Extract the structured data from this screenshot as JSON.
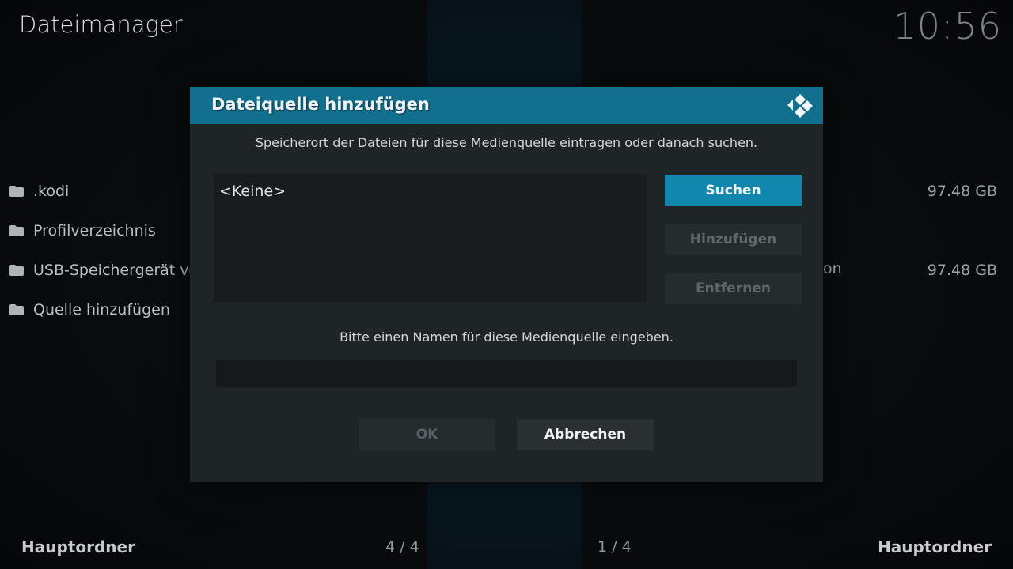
{
  "app": {
    "title": "Dateimanager",
    "clock": "10:56"
  },
  "left_pane": {
    "items": [
      {
        "label": ".kodi"
      },
      {
        "label": "Profilverzeichnis"
      },
      {
        "label": "USB-Speichergerät vo"
      },
      {
        "label": "Quelle hinzufügen"
      }
    ],
    "footer_title": "Hauptordner",
    "footer_count": "4 / 4"
  },
  "right_pane": {
    "sizes": [
      "97.48 GB",
      "97.48 GB"
    ],
    "partial_label": "on",
    "footer_title": "Hauptordner",
    "footer_count": "1 / 4"
  },
  "dialog": {
    "title": "Dateiquelle hinzufügen",
    "location_hint": "Speicherort der Dateien für diese Medienquelle eintragen oder danach suchen.",
    "path_items": [
      "<Keine>"
    ],
    "buttons": {
      "browse": "Suchen",
      "add": "Hinzufügen",
      "remove": "Entfernen"
    },
    "name_hint": "Bitte einen Namen für diese Medienquelle eingeben.",
    "name_value": "",
    "ok": "OK",
    "cancel": "Abbrechen",
    "logo_icon": "kodi-logo-icon"
  },
  "colors": {
    "accent": "#12708f",
    "focus": "#1287ad",
    "dialog_bg": "#1f2427"
  }
}
